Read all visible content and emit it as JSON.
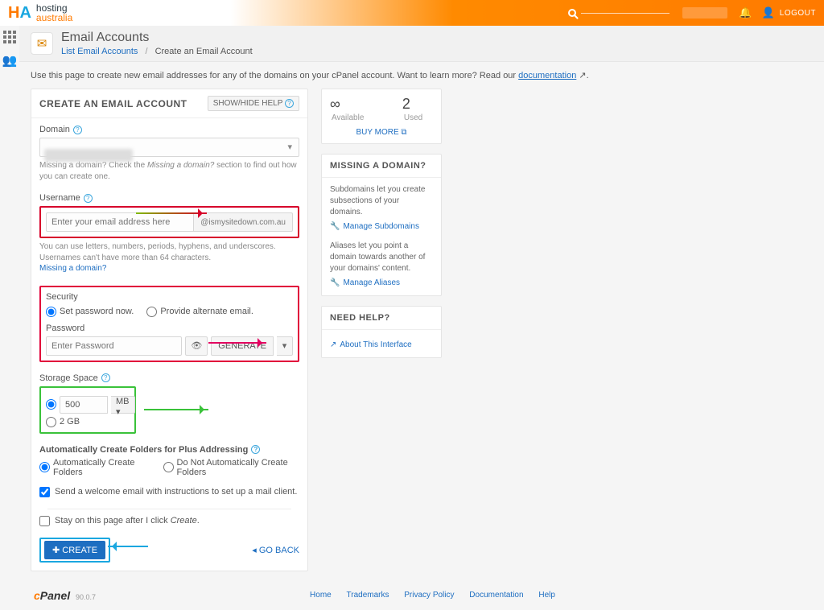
{
  "topbar": {
    "brand_top": "hosting",
    "brand_bottom": "australia",
    "logout": "LOGOUT"
  },
  "header": {
    "title": "Email Accounts",
    "list_link": "List Email Accounts",
    "current": "Create an Email Account"
  },
  "intro": {
    "text_a": "Use this page to create new email addresses for any of the domains on your cPanel account. Want to learn more? Read our ",
    "doc_link": "documentation",
    "text_b": "."
  },
  "form": {
    "panel_title": "CREATE AN EMAIL ACCOUNT",
    "toggle_help": "SHOW/HIDE HELP",
    "domain_label": "Domain",
    "domain_hint_a": "Missing a domain? Check the ",
    "domain_hint_b": "Missing a domain?",
    "domain_hint_c": " section to find out how you can create one.",
    "username_label": "Username",
    "username_placeholder": "Enter your email address here",
    "domain_suffix": "@ismysitedown.com.au",
    "username_hint_1": "You can use letters, numbers, periods, hyphens, and underscores.",
    "username_hint_2": "Usernames can't have more than 64 characters.",
    "missing_domain_link": "Missing a domain?",
    "security_label": "Security",
    "sec_opt_now": "Set password now.",
    "sec_opt_alt": "Provide alternate email.",
    "password_label": "Password",
    "password_placeholder": "Enter Password",
    "generate": "GENERATE",
    "storage_label": "Storage Space",
    "storage_value": "500",
    "storage_unit": "MB",
    "storage_alt": "2 GB",
    "plus_title": "Automatically Create Folders for Plus Addressing",
    "plus_opt_a": "Automatically Create Folders",
    "plus_opt_b": "Do Not Automatically Create Folders",
    "welcome_label": "Send a welcome email with instructions to set up a mail client.",
    "stay_label": "Stay on this page after I click ",
    "stay_em": "Create",
    "stay_suffix": ".",
    "create_btn": "CREATE",
    "go_back": "GO BACK"
  },
  "stats": {
    "available_label": "Available",
    "used_val": "2",
    "used_label": "Used",
    "buy_more": "BUY MORE"
  },
  "missing_panel": {
    "title": "MISSING A DOMAIN?",
    "p1": "Subdomains let you create subsections of your domains.",
    "link1": "Manage Subdomains",
    "p2": "Aliases let you point a domain towards another of your domains' content.",
    "link2": "Manage Aliases"
  },
  "help_panel": {
    "title": "NEED HELP?",
    "link": "About This Interface"
  },
  "footer": {
    "cpanel_ver": "90.0.7",
    "links": [
      "Home",
      "Trademarks",
      "Privacy Policy",
      "Documentation",
      "Help"
    ]
  }
}
